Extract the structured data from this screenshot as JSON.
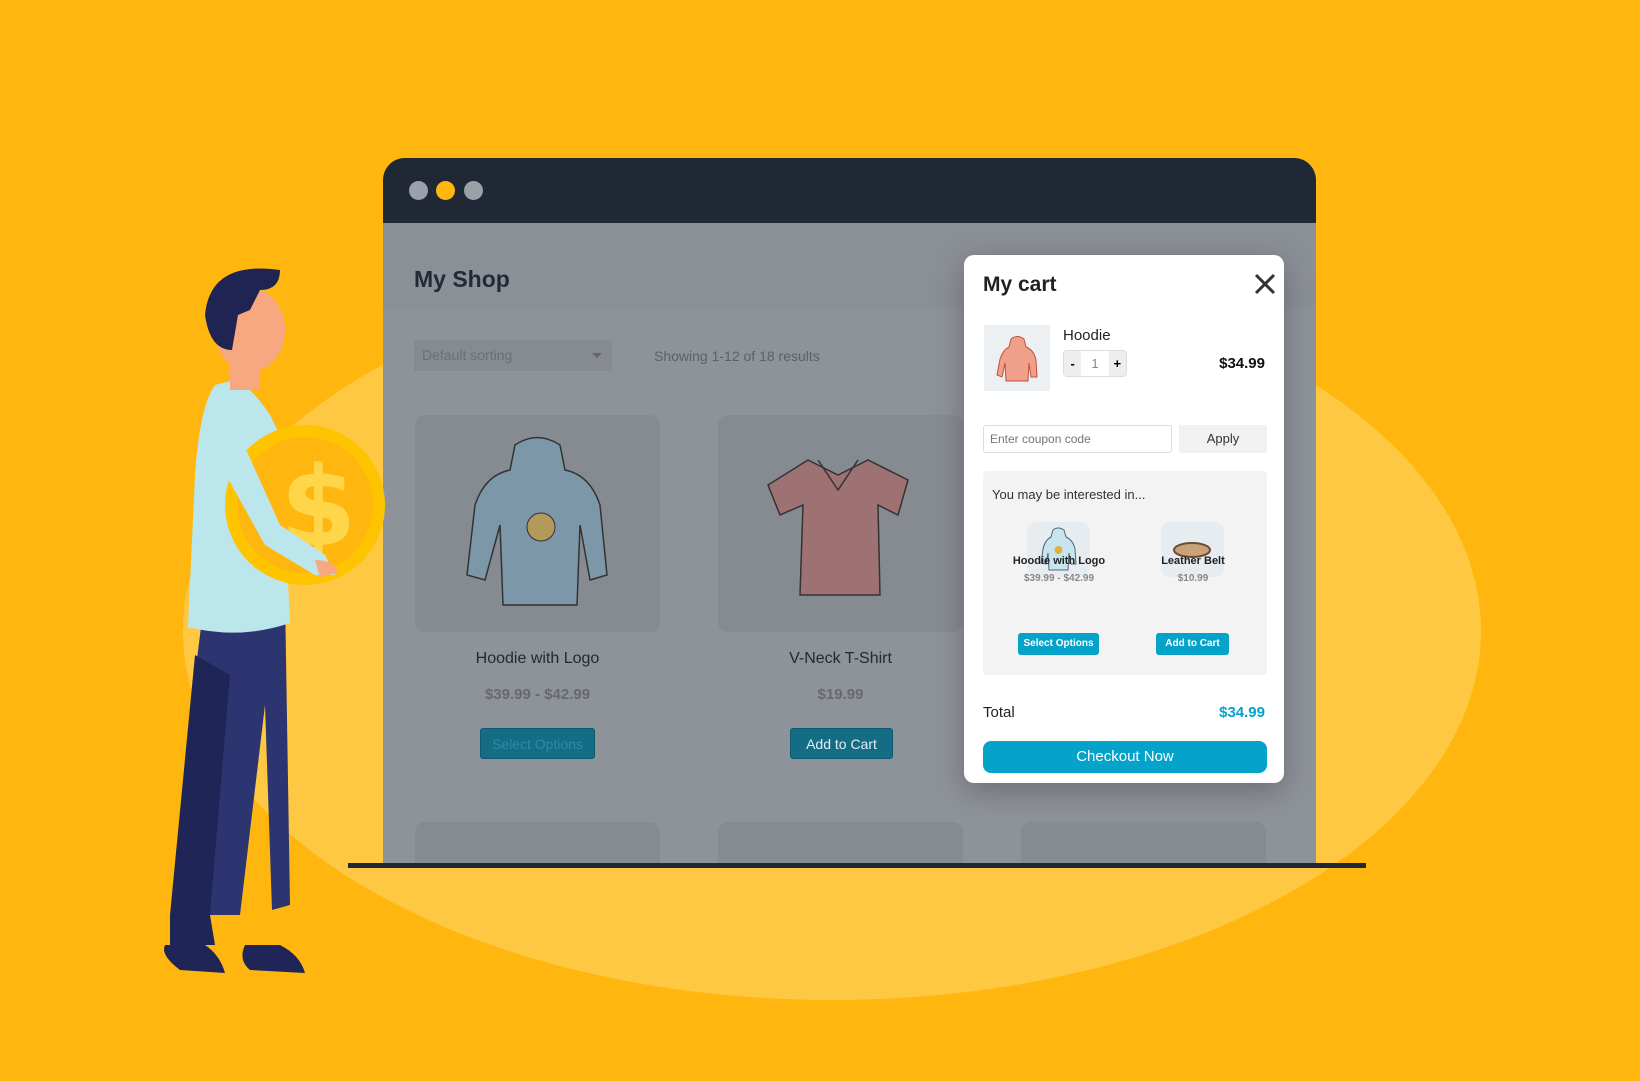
{
  "colors": {
    "background": "#FFB70F",
    "accent": "#05A3C9",
    "titlebar": "#212835"
  },
  "window": {
    "dots": [
      "#9CA0A8",
      "#FFB70F",
      "#9CA0A8"
    ]
  },
  "shop": {
    "title": "My Shop",
    "sorting": "Default sorting",
    "results": "Showing 1-12 of 18 results",
    "products": [
      {
        "name": "Hoodie with Logo",
        "price": "$39.99 - $42.99",
        "button": "Select Options"
      },
      {
        "name": "V-Neck T-Shirt",
        "price": "$19.99",
        "button": "Add to Cart"
      }
    ]
  },
  "cart": {
    "title": "My cart",
    "item": {
      "name": "Hoodie",
      "quantity": "1",
      "price": "$34.99",
      "minus": "-",
      "plus": "+"
    },
    "coupon_placeholder": "Enter coupon code",
    "apply": "Apply",
    "recommend_title": "You may be interested in...",
    "recommendations": [
      {
        "name": "Hoodie with Logo",
        "price": "$39.99 - $42.99",
        "button": "Select Options"
      },
      {
        "name": "Leather Belt",
        "price": "$10.99",
        "button": "Add to Cart"
      }
    ],
    "total_label": "Total",
    "total_value": "$34.99",
    "checkout": "Checkout Now"
  }
}
